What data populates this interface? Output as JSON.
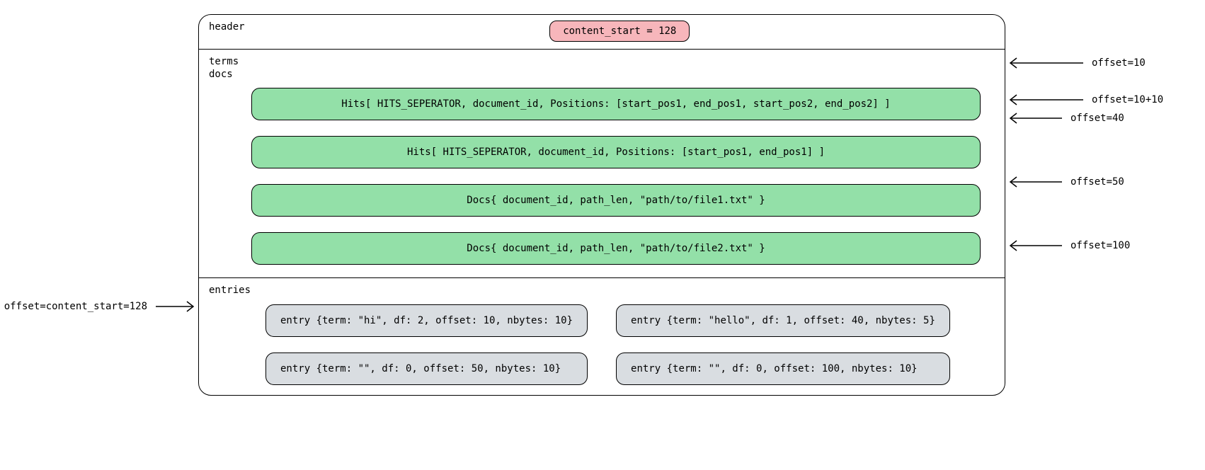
{
  "sections": {
    "header": {
      "label": "header",
      "content_start_badge": "content_start = 128"
    },
    "terms_docs": {
      "label_line1": "terms",
      "label_line2": "docs",
      "blocks": [
        "Hits[ HITS_SEPERATOR, document_id, Positions: [start_pos1, end_pos1, start_pos2, end_pos2]  ]",
        "Hits[ HITS_SEPERATOR, document_id, Positions: [start_pos1, end_pos1]  ]",
        "Docs{ document_id, path_len, \"path/to/file1.txt\" }",
        "Docs{ document_id, path_len, \"path/to/file2.txt\" }"
      ]
    },
    "entries": {
      "label": "entries",
      "items": [
        "entry {term: \"hi\", df: 2, offset: 10, nbytes: 10}",
        "entry {term: \"hello\", df: 1, offset: 40, nbytes: 5}",
        "entry {term: \"\", df: 0, offset: 50, nbytes: 10}",
        "entry {term: \"\", df: 0, offset: 100, nbytes: 10}"
      ]
    }
  },
  "annotations": {
    "left": {
      "content_start": "offset=content_start=128"
    },
    "right": {
      "o10": "offset=10",
      "o10_10": "offset=10+10",
      "o40": "offset=40",
      "o50": "offset=50",
      "o100": "offset=100"
    }
  }
}
